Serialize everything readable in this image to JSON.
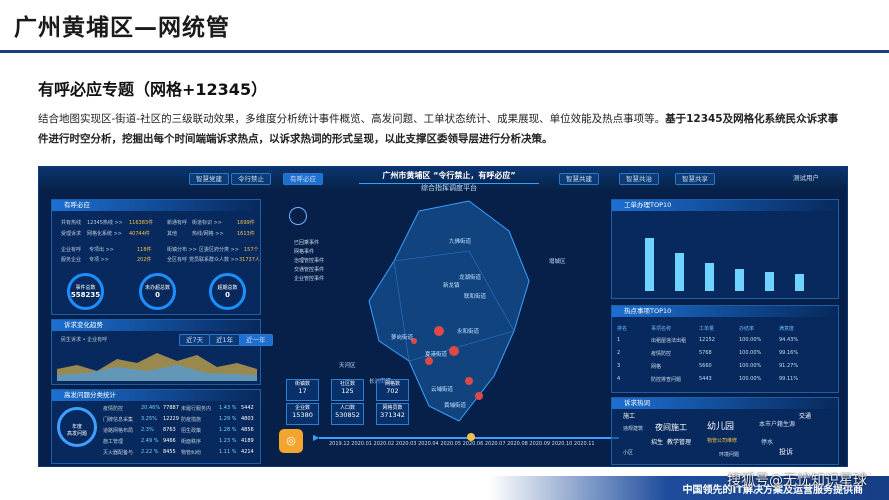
{
  "slide": {
    "title": "广州黄埔区—网统管",
    "subtitle": "有呼必应专题（网格+12345）",
    "desc_normal": "结合地图实现区-街道-社区的三级联动效果，多维度分析统计事件概览、高发问题、工单状态统计、成果展现、单位效能及热点事项等。",
    "desc_bold": "基于12345及网格化系统民众诉求事件进行时空分析，挖掘出每个时间端端诉求热点，以诉求热词的形式呈现，以此支撑区委领导层进行分析决策。"
  },
  "dashboard": {
    "title": "广州市黄埔区 “令行禁止，有呼必应”",
    "subtitle": "综合指挥调度平台",
    "user": "测试用户",
    "tabs_left": [
      "智慧党建",
      "令行禁止",
      "有呼必应"
    ],
    "tabs_right": [
      "智慧共建",
      "智慧共治",
      "智慧共享"
    ],
    "left_panel_title": "有呼必应",
    "kv": [
      "共有热线",
      "12345热线 >>",
      "116383件",
      "新通有呼",
      "街道标识 >>",
      "1699件",
      "受理诉求",
      "网格化系统 >>",
      "40744件",
      "其他",
      "热线/网格 >>",
      "1613件",
      "企业有呼",
      "专项出 >>",
      "118件",
      "街镇分布 >>",
      "区委区府分类 >>",
      "157个",
      "服务企业",
      "专项 >>",
      "202件",
      "全区有呼",
      "党员联系群众人数 >>",
      "31737人"
    ],
    "circles": [
      {
        "label": "事件总数",
        "value": "558235"
      },
      {
        "label": "未办超总数",
        "value": "0"
      },
      {
        "label": "超期总数",
        "value": "0"
      }
    ],
    "trend_title": "诉求变化趋势",
    "trend_legend": "民生诉求 • 企业有呼",
    "trend_tabs": [
      "近7天",
      "近1年",
      "近一年"
    ],
    "hot_title": "高发问题分类统计",
    "hot_center": "年度\n高发问题",
    "hot_items": [
      {
        "name": "疫情防控",
        "pct": "20.46%",
        "num": "77887"
      },
      {
        "name": "门牌信息采集",
        "pct": "3.25%",
        "num": "12229"
      },
      {
        "name": "道路网格布局",
        "pct": "2.3%",
        "num": "8763"
      },
      {
        "name": "施工管理",
        "pct": "2.49 %",
        "num": "9466"
      },
      {
        "name": "灭火器配备与",
        "pct": "2.22 %",
        "num": "8455"
      },
      {
        "name": "未履行服务内",
        "pct": "1.43 %",
        "num": "5442"
      },
      {
        "name": "防疫措施",
        "pct": "1.29 %",
        "num": "4803"
      },
      {
        "name": "招生政策",
        "pct": "1.28 %",
        "num": "4856"
      },
      {
        "name": "街面秩序",
        "pct": "1.23 %",
        "num": "4189"
      },
      {
        "name": "物管纠纷",
        "pct": "1.11 %",
        "num": "4214"
      }
    ],
    "map_legend": [
      "已回乘事件",
      "网格事件",
      "治理管控事件",
      "交通管控事件",
      "企业管控事件"
    ],
    "map_labels": [
      "九佛街道",
      "龙湖街道",
      "新龙镇",
      "永和街道",
      "联和街道",
      "萝岗街道",
      "夏港街道",
      "云埔街道",
      "黄埔街道",
      "长洲街道",
      "增城区",
      "天河区"
    ],
    "stats": [
      {
        "label": "街镇数",
        "value": "17"
      },
      {
        "label": "社区数",
        "value": "125"
      },
      {
        "label": "网格数",
        "value": "702"
      },
      {
        "label": "企业数",
        "value": "15380"
      },
      {
        "label": "人口数",
        "value": "530852"
      },
      {
        "label": "网格员数",
        "value": "371342"
      }
    ],
    "timeline": "2019.12 2020.01 2020.02 2020.03 2020.04 2020.05 2020.06 2020.07 2020.08 2020.09 2020.10 2020.11",
    "order_title": "工单办理TOP10",
    "order_values": [
      2200,
      1600,
      1150,
      900,
      780,
      700
    ],
    "hotspot_title": "热点事项TOP10",
    "hotspot_headers": [
      "排名",
      "事项名称",
      "工单量",
      "办结率",
      "满意度"
    ],
    "hotspot_rows": [
      [
        "1",
        "出租屋违法出租",
        "12152",
        "100.00%",
        "94.43%"
      ],
      [
        "2",
        "疫情防控",
        "5768",
        "100.00%",
        "99.16%"
      ],
      [
        "3",
        "网格",
        "5660",
        "100.00%",
        "91.27%"
      ],
      [
        "4",
        "防控排查问题",
        "5443",
        "100.00%",
        "99.11%"
      ]
    ],
    "words_title": "诉求热词",
    "words": [
      "施工",
      "夜间施工",
      "幼儿园",
      "本市户籍生源",
      "违规建筑",
      "招生",
      "教学管理",
      "物管公司维修",
      "停水",
      "交通",
      "小区",
      "投诉",
      "环境问题"
    ]
  },
  "footer": {
    "text": "中国领先的IT解决方案及运营服务提供商",
    "watermark": "搜狐号@无忧知识星球"
  }
}
